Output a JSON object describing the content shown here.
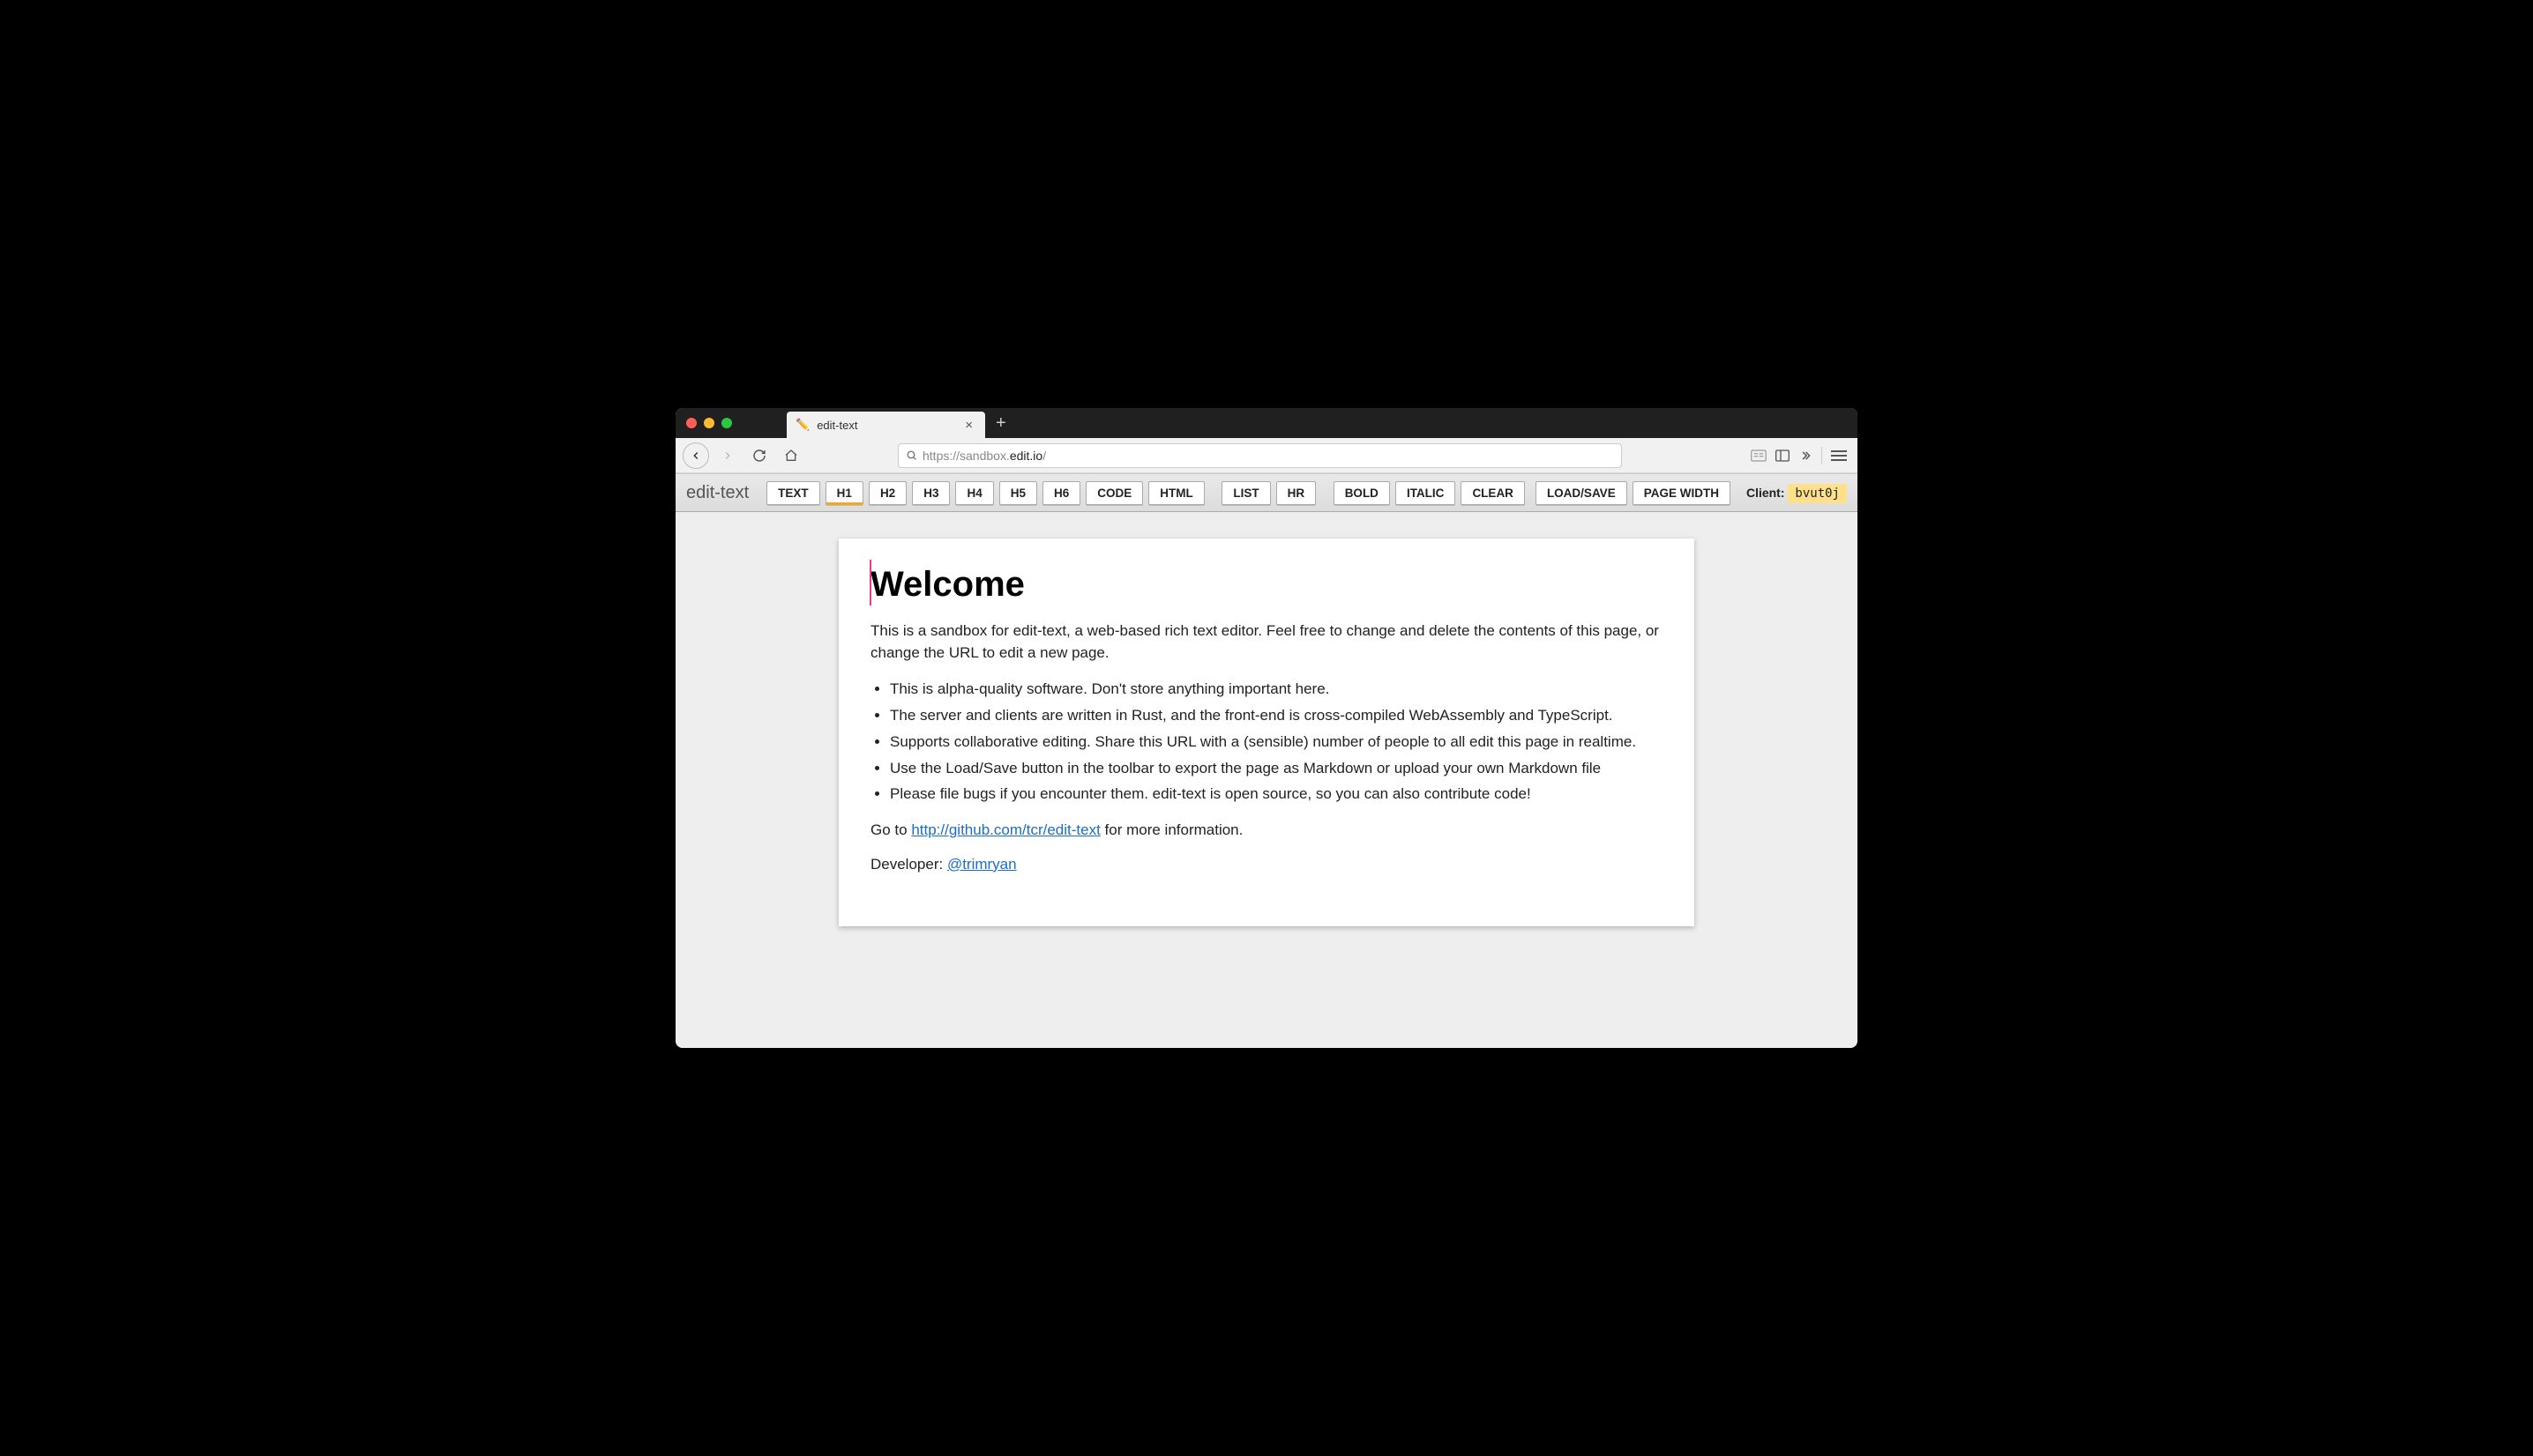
{
  "browser": {
    "tab_title": "edit-text",
    "url_prefix": "https://sandbox.",
    "url_domain": "edit.io",
    "url_path": "/"
  },
  "toolbar": {
    "app_name": "edit-text",
    "buttons": {
      "text": "TEXT",
      "h1": "H1",
      "h2": "H2",
      "h3": "H3",
      "h4": "H4",
      "h5": "H5",
      "h6": "H6",
      "code": "CODE",
      "html": "HTML",
      "list": "LIST",
      "hr": "HR",
      "bold": "BOLD",
      "italic": "ITALIC",
      "clear": "CLEAR",
      "load_save": "LOAD/SAVE",
      "page_width": "PAGE WIDTH"
    },
    "client_label": "Client: ",
    "client_id": "bvut0j"
  },
  "doc": {
    "heading": "Welcome",
    "p1": "This is a sandbox for edit-text, a web-based rich text editor. Feel free to change and delete the contents of this page, or change the URL to edit a new page.",
    "bullets": [
      "This is alpha-quality software. Don't store anything important here.",
      "The server and clients are written in Rust, and the front-end is cross-compiled WebAssembly and TypeScript.",
      "Supports collaborative editing. Share this URL with a (sensible) number of people to all edit this page in realtime.",
      "Use the Load/Save button in the toolbar to export the page as Markdown or upload your own Markdown file",
      "Please file bugs if you encounter them. edit-text is open source, so you can also contribute code!"
    ],
    "p2_pre": "Go to ",
    "p2_link_text": "http://github.com/tcr/edit-text",
    "p2_post": " for more information.",
    "p3_pre": "Developer: ",
    "p3_link_text": "@trimryan"
  }
}
